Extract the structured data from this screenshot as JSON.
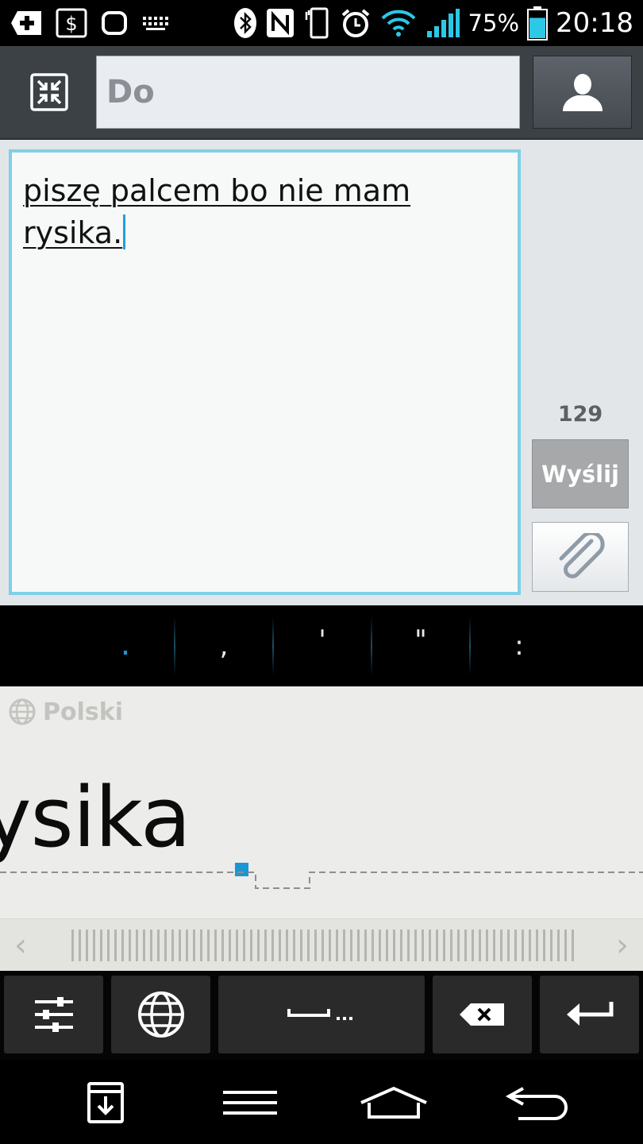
{
  "status_bar": {
    "battery_percent": "75%",
    "time": "20:18",
    "battery_level": 0.75
  },
  "header": {
    "to_placeholder": "Do"
  },
  "compose": {
    "message_text": "piszę palcem bo nie mam rysika.",
    "char_count": "129",
    "send_label": "Wyślij"
  },
  "punctuation": {
    "keys": [
      ".",
      ",",
      "'",
      "\"",
      ":"
    ]
  },
  "handwriting": {
    "language": "Polski",
    "preview_text": "ysika"
  },
  "colors": {
    "accent": "#1b96d2",
    "msg_border": "#7fd0e6"
  }
}
